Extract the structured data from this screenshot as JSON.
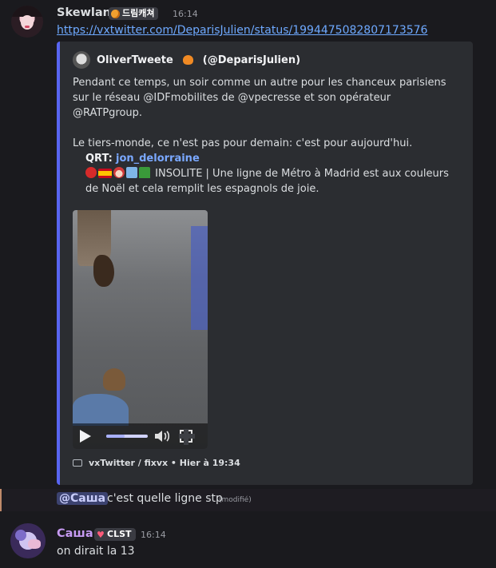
{
  "message1": {
    "username": "Skewlan.",
    "tag": "드림캐쳐",
    "time": "16:14",
    "link": "https://vxtwitter.com/DeparisJulien/status/1994475082807173576",
    "embed": {
      "author": "OliverTweete",
      "handle": "(@DeparisJulien)",
      "paragraph1": "Pendant ce temps, un soir comme un autre pour les chanceux parisiens sur le réseau @IDFmobilites de @vpecresse et son opérateur @RATPgroup.",
      "paragraph2": "Le tiers-monde, ce n'est pas pour demain: c'est pour aujourd'hui.",
      "qrt_label": "QRT:",
      "qrt_user": "jon_delorraine",
      "qrt_text": "INSOLITE | Une ligne de Métro à Madrid est aux couleurs de Noël et cela remplit les espagnols de joie.",
      "footer": "vxTwitter / fixvx • Hier à 19:34",
      "video_progress": 0.45
    }
  },
  "message2": {
    "mention": "@Саша",
    "text": "c'est quelle ligne stp",
    "edited": "(modifié)"
  },
  "message3": {
    "username": "Саша",
    "tag": "CLST",
    "time": "16:14",
    "text": "on dirait la 13"
  },
  "colors": {
    "accent": "#5865f2",
    "link": "#6ea9ff",
    "username2": "#c69af2"
  }
}
